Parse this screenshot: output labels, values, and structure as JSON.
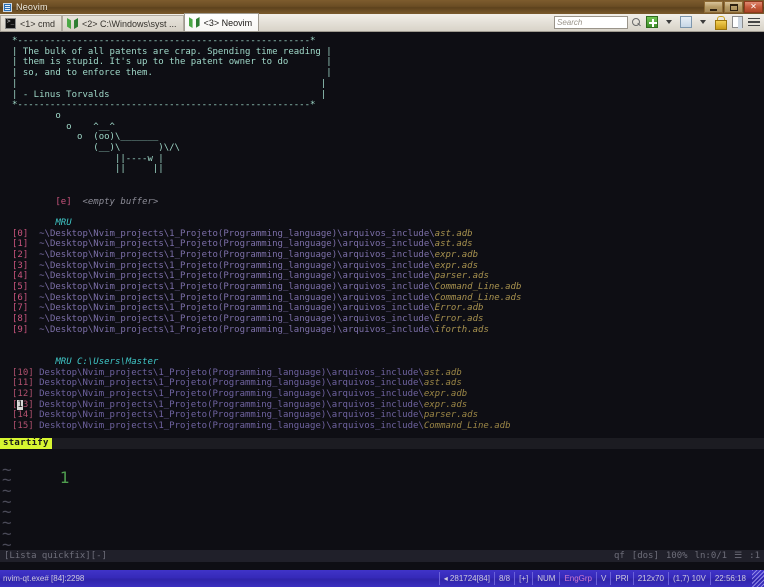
{
  "window": {
    "title": "Neovim",
    "icon": "neovim-window-icon",
    "buttons": {
      "minimize": "minimize-button",
      "restore": "restore-button",
      "close": "close-button"
    }
  },
  "tabbar": {
    "tabs": [
      {
        "label": "<1> cmd",
        "icon": "cmd-console-icon",
        "active": false
      },
      {
        "label": "<2> C:\\Windows\\syst ...",
        "icon": "neovim-icon",
        "active": false
      },
      {
        "label": "<3> Neovim",
        "icon": "neovim-icon",
        "active": true
      }
    ],
    "search": {
      "placeholder": "Search",
      "value": ""
    },
    "tools": [
      {
        "name": "new-console-button",
        "glyph": "plus"
      },
      {
        "name": "new-console-dropdown",
        "glyph": "caret-down"
      },
      {
        "name": "split-pane-button",
        "glyph": "pane"
      },
      {
        "name": "split-pane-dropdown",
        "glyph": "caret-down"
      },
      {
        "name": "lock-button",
        "glyph": "lock"
      },
      {
        "name": "panels-button",
        "glyph": "page"
      },
      {
        "name": "menu-button",
        "glyph": "hamburger"
      }
    ]
  },
  "startify": {
    "quote_box": [
      "*------------------------------------------------------*",
      "| The bulk of all patents are crap. Spending time reading |",
      "| them is stupid. It's up to the patent owner to do       |",
      "| so, and to enforce them.                                |",
      "|                                                        |",
      "| - Linus Torvalds                                       |",
      "*------------------------------------------------------*"
    ],
    "cow_art": [
      "        o",
      "          o    ^__^",
      "            o  (oo)\\_______",
      "               (__)\\       )\\/\\",
      "                   ||----w |",
      "                   ||     ||"
    ],
    "empty_buffer": {
      "key": "[e]",
      "label": "<empty buffer>"
    },
    "mru_header_1": "MRU",
    "mru_header_2": "MRU C:\\Users\\Master",
    "mru_prefix_1": "~\\Desktop\\Nvim_projects\\1_Projeto(Programming_language)\\arquivos_include\\",
    "mru_prefix_2": "Desktop\\Nvim_projects\\1_Projeto(Programming_language)\\arquivos_include\\",
    "mru_1": [
      {
        "key": "[0]",
        "file": "ast.adb"
      },
      {
        "key": "[1]",
        "file": "ast.ads"
      },
      {
        "key": "[2]",
        "file": "expr.adb"
      },
      {
        "key": "[3]",
        "file": "expr.ads"
      },
      {
        "key": "[4]",
        "file": "parser.ads"
      },
      {
        "key": "[5]",
        "file": "Command_Line.adb"
      },
      {
        "key": "[6]",
        "file": "Command_Line.ads"
      },
      {
        "key": "[7]",
        "file": "Error.adb"
      },
      {
        "key": "[8]",
        "file": "Error.ads"
      },
      {
        "key": "[9]",
        "file": "iforth.ads"
      }
    ],
    "mru_2": [
      {
        "key": "[10]",
        "file": "ast.adb",
        "cursor": false
      },
      {
        "key": "[11]",
        "file": "ast.ads",
        "cursor": false
      },
      {
        "key": "[12]",
        "file": "expr.adb",
        "cursor": false
      },
      {
        "key": "[13]",
        "file": "expr.ads",
        "cursor": true,
        "cursor_char": "1"
      },
      {
        "key": "[14]",
        "file": "parser.ads",
        "cursor": false
      },
      {
        "key": "[15]",
        "file": "Command_Line.adb",
        "cursor": false
      }
    ],
    "statusline_label": "startify"
  },
  "quickfix": {
    "line_number": "1",
    "tildes": 8,
    "statusline_left": "[Lista quickfix][-]",
    "statusline_right": {
      "type": "qf",
      "fileformat": "[dos]",
      "percent": "100%",
      "line_info": "ln:0/1",
      "col_icon": "☰",
      "column": ":1"
    }
  },
  "conemu": {
    "left": "nvim-qt.exe# [84]:2298",
    "cells": [
      {
        "name": "memory",
        "text": "◂ 281724[84]"
      },
      {
        "name": "tab-count",
        "text": "8/8"
      },
      {
        "name": "modified-flag",
        "text": "[+]"
      },
      {
        "name": "num-lock",
        "text": "NUM"
      },
      {
        "name": "keyboard-layout",
        "text": "EngGrp",
        "accent": true
      },
      {
        "name": "visual-mode",
        "text": "V"
      },
      {
        "name": "priority",
        "text": "PRI"
      },
      {
        "name": "console-size",
        "text": "212x70"
      },
      {
        "name": "cursor-position",
        "text": "(1,7) 10V"
      },
      {
        "name": "clock",
        "text": "22:56:18"
      }
    ]
  },
  "colors": {
    "terminal_bg": "#0e0e14",
    "quote_fg": "#9fdcc9",
    "index_fg": "#c9547d",
    "path_fg": "#7c6fa8",
    "filename_fg": "#a8924f",
    "header_fg": "#3fc7c7",
    "badge_bg": "#d7f531",
    "conemu_bg": "#3529b8"
  }
}
